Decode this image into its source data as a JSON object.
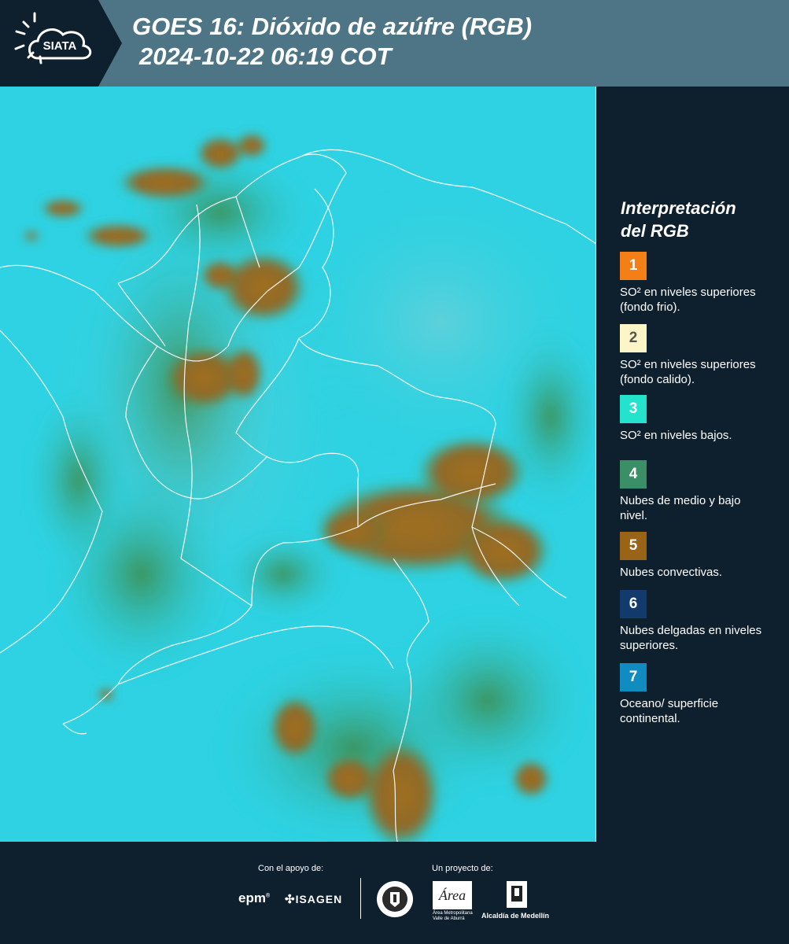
{
  "header": {
    "title_line1": "GOES 16: Dióxido de azúfre (RGB)",
    "title_line2": "2024-10-22 06:19 COT",
    "logo_text": "SIATA",
    "brand_color": "#4e7585"
  },
  "legend": {
    "title_line1": "Interpretación",
    "title_line2": "del RGB",
    "items": [
      {
        "num": "1",
        "label": "SO² en niveles superiores (fondo frio).",
        "color": "#f47f16",
        "text_color": "#ffffff"
      },
      {
        "num": "2",
        "label": "SO² en niveles superiores (fondo calido).",
        "color": "#fcf6c7",
        "text_color": "#555555"
      },
      {
        "num": "3",
        "label": "SO² en niveles bajos.",
        "color": "#24e3cd",
        "text_color": "#ffffff"
      },
      {
        "num": "4",
        "label": "Nubes de medio y bajo nivel.",
        "color": "#3a8f66",
        "text_color": "#ffffff"
      },
      {
        "num": "5",
        "label": "Nubes convectivas.",
        "color": "#9a6416",
        "text_color": "#ffffff"
      },
      {
        "num": "6",
        "label": "Nubes delgadas en niveles superiores.",
        "color": "#123a6c",
        "text_color": "#ffffff"
      },
      {
        "num": "7",
        "label": "Oceano/ superficie continental.",
        "color": "#118cc0",
        "text_color": "#ffffff"
      }
    ]
  },
  "map": {
    "background_color": "#2dd0e0",
    "cloud_color": "#9a6a22",
    "vegetation_color": "#3f8c45",
    "border_color": "#ffffff"
  },
  "footer": {
    "support_label": "Con el apoyo de:",
    "project_label": "Un proyecto de:",
    "sponsors": [
      "epm",
      "ISAGEN"
    ],
    "partners": [
      "Área Metropolitana Valle de Aburrá",
      "Alcaldía de Medellín"
    ]
  }
}
